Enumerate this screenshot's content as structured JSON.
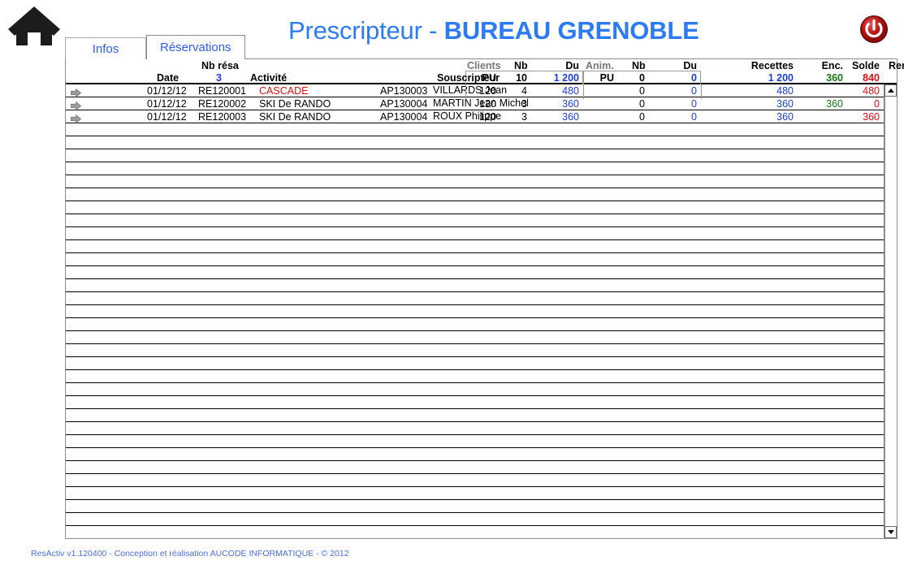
{
  "window": {
    "title_prefix": "Prescripteur - ",
    "title_main": "BUREAU GRENOBLE",
    "home_icon": "home-icon",
    "power_icon": "power-icon",
    "footer": "ResActiv v1.120400 - Conception et réalisation AUCODE INFORMATIQUE - © 2012"
  },
  "tabs": [
    {
      "label": "Infos",
      "active": false
    },
    {
      "label": "Réservations",
      "active": true
    }
  ],
  "table": {
    "group_headers": [
      {
        "label": "Clients"
      },
      {
        "label": "Anim."
      }
    ],
    "columns": [
      {
        "key": "date",
        "label": "Date"
      },
      {
        "key": "nbresa",
        "label": "Nb résa"
      },
      {
        "key": "activite",
        "label": "Activité"
      },
      {
        "key": "souscripteur",
        "label": "Souscripteur"
      },
      {
        "key": "cli_pu",
        "label": "PU"
      },
      {
        "key": "cli_nb",
        "label": "Nb"
      },
      {
        "key": "cli_du",
        "label": "Du"
      },
      {
        "key": "ani_pu",
        "label": "PU"
      },
      {
        "key": "ani_nb",
        "label": "Nb"
      },
      {
        "key": "ani_du",
        "label": "Du"
      },
      {
        "key": "recettes",
        "label": "Recettes"
      },
      {
        "key": "enc",
        "label": "Enc."
      },
      {
        "key": "solde",
        "label": "Solde"
      },
      {
        "key": "remb",
        "label": "Remb."
      }
    ],
    "totals": {
      "nb_resa": "3",
      "cli_pu": "PU",
      "cli_nb": "10",
      "cli_du": "1 200",
      "ani_pu": "PU",
      "ani_nb": "0",
      "ani_du": "0",
      "recettes": "1 200",
      "enc": "360",
      "solde": "840",
      "remb": ""
    },
    "rows": [
      {
        "date": "01/12/12",
        "num": "RE120001",
        "activite": "CASCADE",
        "activite_color": "red",
        "code_client": "AP130003",
        "souscripteur": "VILLARDS Jean Claude",
        "cli_pu": "120",
        "cli_nb": "4",
        "cli_du": "480",
        "ani_nb": "0",
        "ani_du": "0",
        "recettes": "480",
        "enc": "",
        "solde": "480",
        "remb": ""
      },
      {
        "date": "01/12/12",
        "num": "RE120002",
        "activite": "SKI De RANDO",
        "activite_color": "black",
        "code_client": "AP130004",
        "souscripteur": "MARTIN Jean Michel",
        "cli_pu": "120",
        "cli_nb": "3",
        "cli_du": "360",
        "ani_nb": "0",
        "ani_du": "0",
        "recettes": "360",
        "enc": "360",
        "solde": "0",
        "remb": ""
      },
      {
        "date": "01/12/12",
        "num": "RE120003",
        "activite": "SKI De RANDO",
        "activite_color": "black",
        "code_client": "AP130004",
        "souscripteur": "ROUX Philippe",
        "cli_pu": "120",
        "cli_nb": "3",
        "cli_du": "360",
        "ani_nb": "0",
        "ani_du": "0",
        "recettes": "360",
        "enc": "",
        "solde": "360",
        "remb": ""
      }
    ],
    "empty_row_count": 32
  },
  "scrollbar": {
    "up_icon": "triangle-up-icon",
    "down_icon": "triangle-down-icon"
  },
  "colors": {
    "accent_blue": "#2b7bf6",
    "value_blue": "#1a3fe0",
    "value_red": "#e01010",
    "value_green": "#127a12",
    "header_gray": "#777777"
  }
}
